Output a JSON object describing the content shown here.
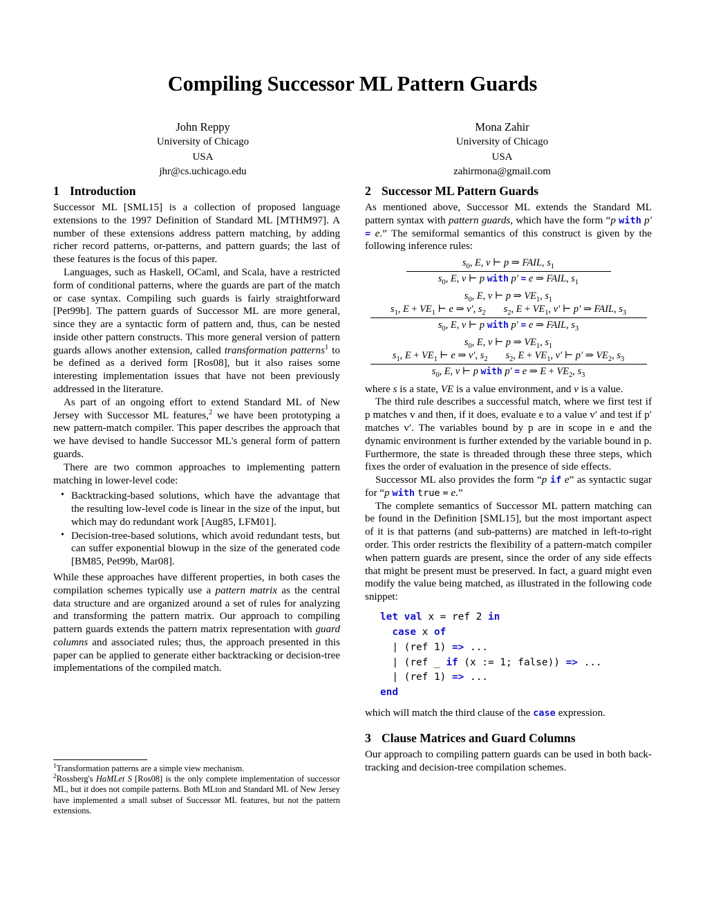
{
  "paper": {
    "title": "Compiling Successor ML Pattern Guards",
    "authors": [
      {
        "name": "John Reppy",
        "affiliation": "University of Chicago",
        "country": "USA",
        "email": "jhr@cs.uchicago.edu"
      },
      {
        "name": "Mona Zahir",
        "affiliation": "University of Chicago",
        "country": "USA",
        "email": "zahirmona@gmail.com"
      }
    ],
    "accent_color": "#1616cc"
  },
  "sections": {
    "intro": {
      "number": "1",
      "heading": "Introduction",
      "p1": "Successor ML [SML15] is a collection of proposed language extensions to the 1997 Definition of Standard ML [MTHM97]. A number of these extensions address pattern matching, by adding richer record patterns, or-patterns, and pattern guards; the last of these features is the focus of this paper.",
      "p2_a": "Languages, such as Haskell, OCaml, and Scala, have a restricted form of conditional patterns, where the guards are part of the match or case syntax. Compiling such guards is fairly straightforward [Pet99b]. The pattern guards of Successor ML are more general, since they are a syntactic form of pattern and, thus, can be nested inside other pattern constructs. This more general version of pattern guards allows another extension, called ",
      "p2_italic": "transformation patterns",
      "p2_sup": "1",
      "p2_b": " to be defined as a derived form [Ros08], but it also raises some interesting implementation issues that have not been previously addressed in the literature.",
      "p3_a": "As part of an ongoing effort to extend Standard ML of New Jersey with Successor ML features,",
      "p3_sup": "2",
      "p3_b": " we have been prototyping a new pattern-match compiler. This paper describes the approach that we have devised to handle Successor ML's general form of pattern guards.",
      "p4": "There are two common approaches to implementing pattern matching in lower-level code:",
      "bullets": [
        "Backtracking-based solutions, which have the advantage that the resulting low-level code is linear in the size of the input, but which may do redundant work [Aug85, LFM01].",
        "Decision-tree-based solutions, which avoid redundant tests, but can suffer exponential blowup in the size of the generated code [BM85, Pet99b, Mar08]."
      ],
      "p5_a": "While these approaches have different properties, in both cases the compilation schemes typically use a ",
      "p5_italic1": "pattern matrix",
      "p5_b": " as the central data structure and are organized around a set of rules for analyzing and transforming the pattern matrix. Our approach to compiling pattern guards extends the pattern matrix representation with ",
      "p5_italic2": "guard columns",
      "p5_c": " and associated rules; thus, the approach presented in this paper can be applied to generate either backtracking or decision-tree implementations of the compiled match."
    },
    "guards": {
      "number": "2",
      "heading": "Successor ML Pattern Guards",
      "p1_a": "As mentioned above, Successor ML extends the Standard ML pattern syntax with ",
      "p1_italic": "pattern guards",
      "p1_b": ", which have the form “",
      "p1_p": "p",
      "p1_with": "with",
      "p1_pprime": "p′",
      "p1_eq": "=",
      "p1_e": "e",
      "p1_c": ".” The semiformal semantics of this construct is given by the following inference rules:",
      "p2_a": "where ",
      "p2_s": "s",
      "p2_b": " is a state, ",
      "p2_ve": "VE",
      "p2_c": " is a value environment, and ",
      "p2_v": "v",
      "p2_d": " is a value.",
      "p3": "The third rule describes a successful match, where we first test if p matches v and then, if it does, evaluate e to a value v′ and test if p′ matches v′. The variables bound by p are in scope in e and the dynamic environment is further extended by the variable bound in p. Furthermore, the state is threaded through these three steps, which fixes the order of evaluation in the presence of side effects.",
      "p4_a": "Successor ML also provides the form “",
      "p4_p": "p",
      "p4_if": "if",
      "p4_e": "e",
      "p4_b": "” as syntactic sugar for “",
      "p4_p2": "p",
      "p4_with": "with",
      "p4_true": "true",
      "p4_eq": "=",
      "p4_e2": "e",
      "p4_c": ".”",
      "p5": "The complete semantics of Successor ML pattern matching can be found in the Definition [SML15], but the most important aspect of it is that patterns (and sub-patterns) are matched in left-to-right order. This order restricts the flexibility of a pattern-match compiler when pattern guards are present, since the order of any side effects that might be present must be preserved. In fact, a guard might even modify the value being matched, as illustrated in the following code snippet:",
      "p6_a": "which will match the third clause of the ",
      "p6_case": "case",
      "p6_b": " expression."
    },
    "clause": {
      "number": "3",
      "heading": "Clause Matrices and Guard Columns",
      "p1": "Our approach to compiling pattern guards can be used in both back-tracking and decision-tree compilation schemes."
    }
  },
  "inference_rules": [
    {
      "id": "rule-1",
      "premises": [
        [
          "s0, E, v ⊢ p ⇒ FAIL, s1"
        ]
      ],
      "conclusion": "s0, E, v ⊢ p with p′ = e ⇒ FAIL, s1"
    },
    {
      "id": "rule-2",
      "premises": [
        [
          "s0, E, v ⊢ p ⇒ VE1, s1"
        ],
        [
          "s1, E + VE1 ⊢ e ⇒ v′, s2",
          "s2, E + VE1, v′ ⊢ p′ ⇒ FAIL, s3"
        ]
      ],
      "conclusion": "s0, E, v ⊢ p with p′ = e ⇒ FAIL, s3"
    },
    {
      "id": "rule-3",
      "premises": [
        [
          "s0, E, v ⊢ p ⇒ VE1, s1"
        ],
        [
          "s1, E + VE1 ⊢ e ⇒ v′, s2",
          "s2, E + VE1, v′ ⊢ p′ ⇒ VE2, s3"
        ]
      ],
      "conclusion": "s0, E, v ⊢ p with p′ = e ⇒ E + VE2, s3"
    }
  ],
  "code_snippet": {
    "lines": [
      "let val x = ref 2 in",
      "  case x of",
      "  | (ref 1) => ...",
      "  | (ref _ if (x := 1; false)) => ...",
      "  | (ref 1) => ...",
      "end"
    ]
  },
  "footnotes": [
    {
      "marker": "1",
      "text": "Transformation patterns are a simple view mechanism."
    },
    {
      "marker": "2",
      "text_a": "Rossberg's ",
      "text_italic": "HaMLet S",
      "text_b": " [Ros08] is the only complete implementation of successor ML, but it does not compile patterns. Both MLton and Standard ML of New Jersey have implemented a small subset of Successor ML features, but not the pattern extensions."
    }
  ]
}
